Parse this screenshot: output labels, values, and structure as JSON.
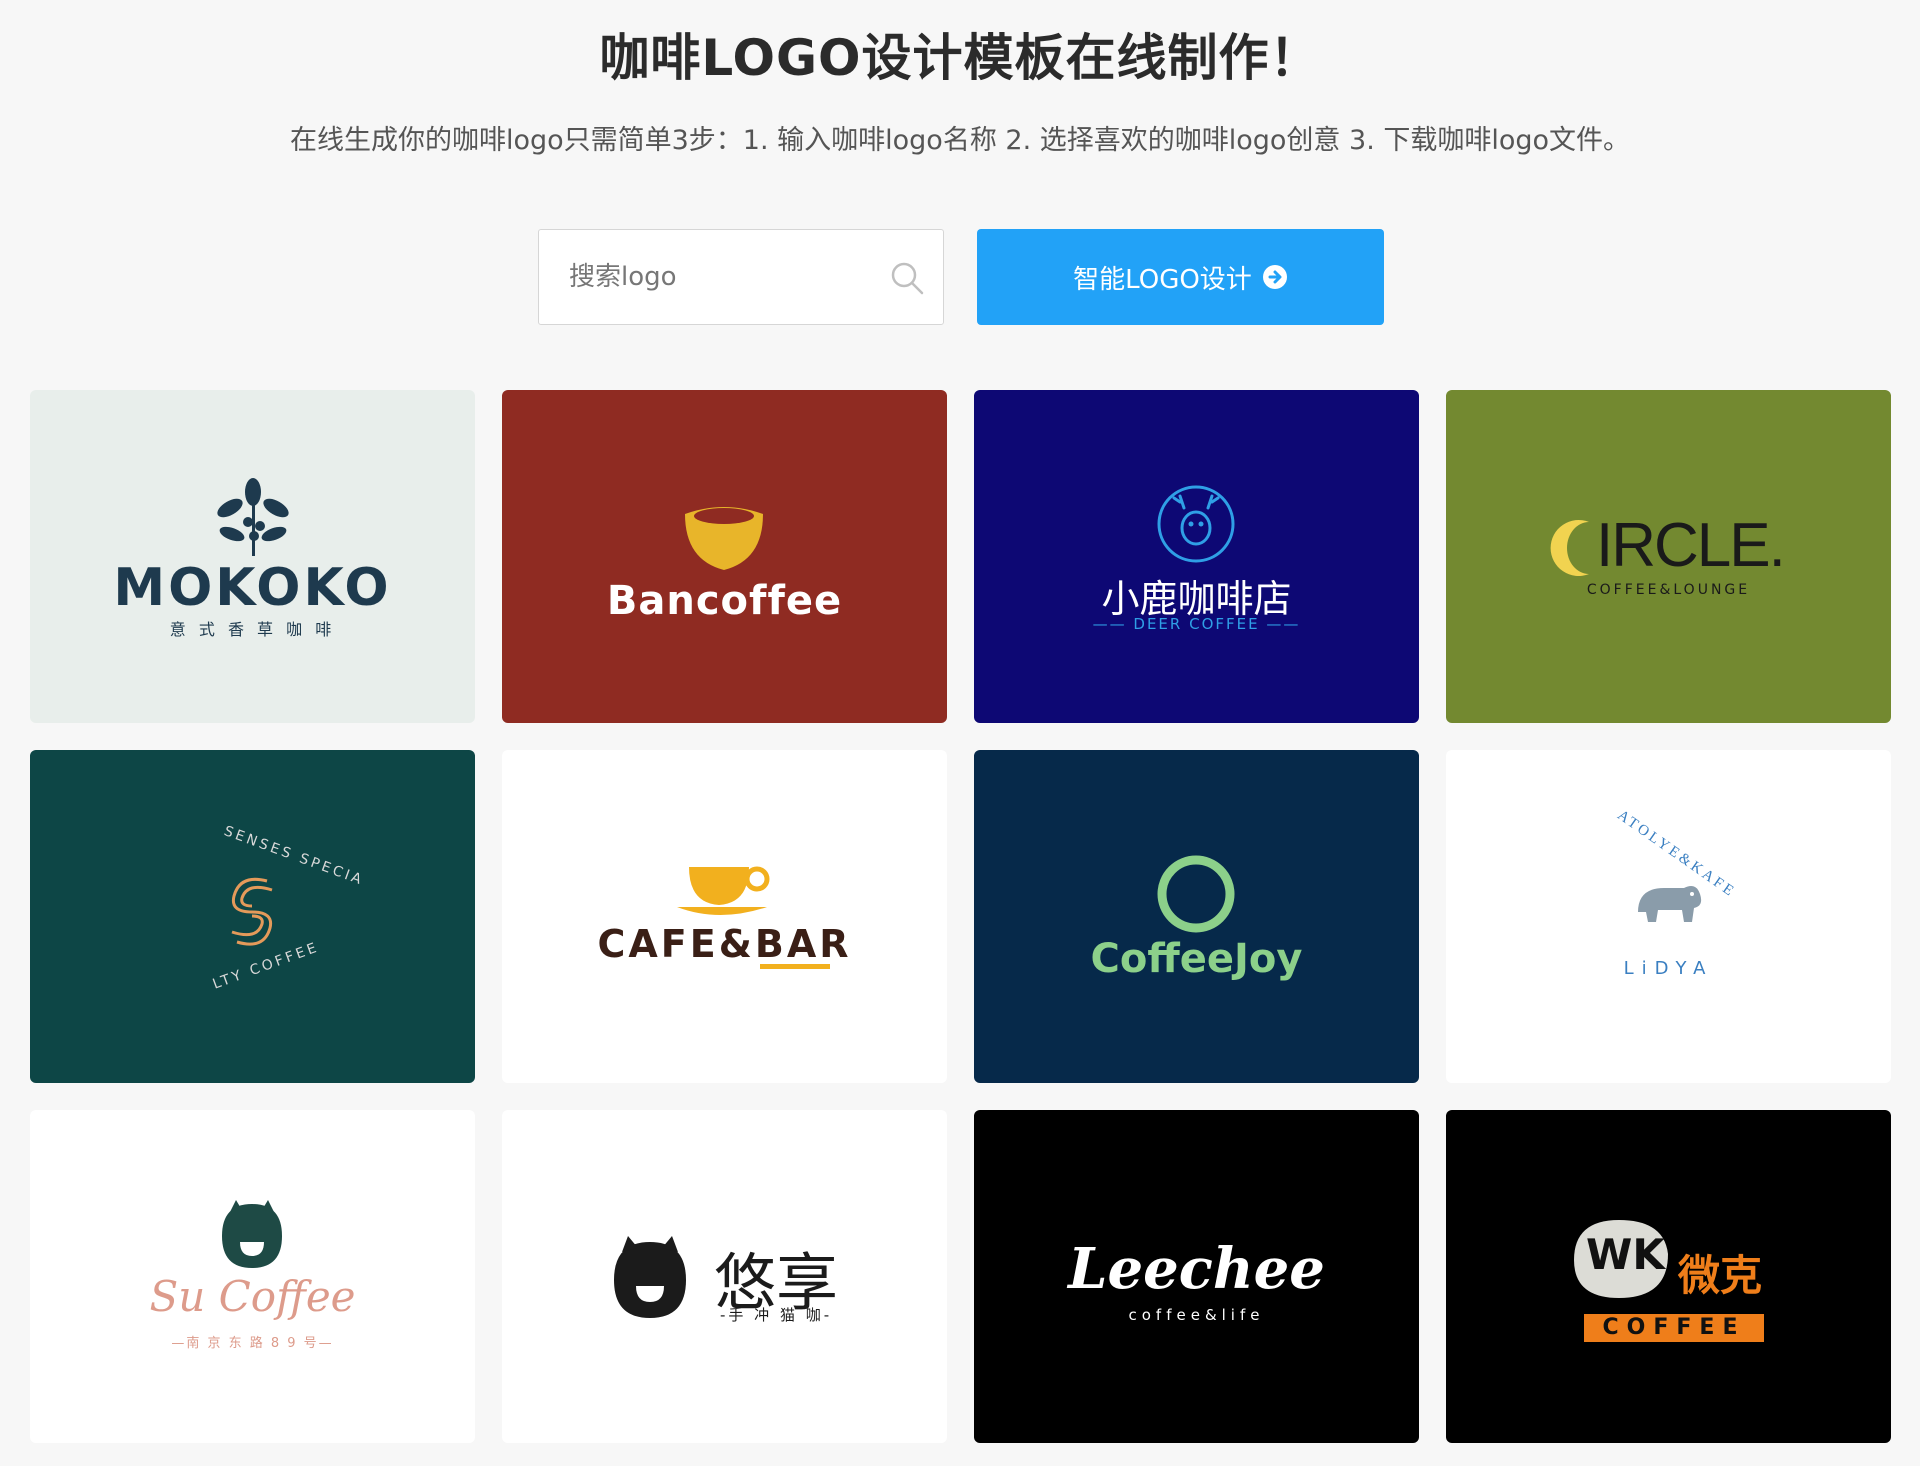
{
  "page": {
    "title": "咖啡LOGO设计模板在线制作！",
    "subtitle": "在线生成你的咖啡logo只需简单3步：1. 输入咖啡logo名称 2. 选择喜欢的咖啡logo创意 3. 下载咖啡logo文件。"
  },
  "search": {
    "placeholder": "搜索logo",
    "value": ""
  },
  "ai_button": {
    "label": "智能LOGO设计"
  },
  "colors": {
    "accent": "#22a2f7"
  },
  "cards": [
    {
      "name": "MOKOKO",
      "tagline": "意 式 香 草 咖 啡",
      "bg": "#e8eeeb"
    },
    {
      "name": "Bancoffee",
      "bg": "#8f2b22"
    },
    {
      "name": "小鹿咖啡店",
      "tagline": "DEER COFFEE",
      "bg": "#0d0874"
    },
    {
      "name": "IRCLE.",
      "tagline": "COFFEE&LOUNGE",
      "bg": "#738930"
    },
    {
      "ring_top": "SENSES SPECIA",
      "ring_bottom": "LTY COFFEE",
      "bg": "#0d4646"
    },
    {
      "name": "CAFE&BAR",
      "bg": "#ffffff"
    },
    {
      "name": "CoffeeJoy",
      "bg": "#06294a"
    },
    {
      "ring_top": "ATOLYE&KAFE",
      "ring_bottom": "LiDYA",
      "bg": "#ffffff"
    },
    {
      "name": "Su Coffee",
      "tagline": "—南 京 东 路 8 9 号—",
      "bg": "#ffffff"
    },
    {
      "name": "悠享",
      "tagline": "-手 冲 猫 咖-",
      "bg": "#ffffff"
    },
    {
      "name": "Leechee",
      "tagline": "coffee&life",
      "bg": "#000000"
    },
    {
      "badge": "WK",
      "name": "微克",
      "tagline": "COFFEE",
      "bg": "#000000"
    }
  ]
}
